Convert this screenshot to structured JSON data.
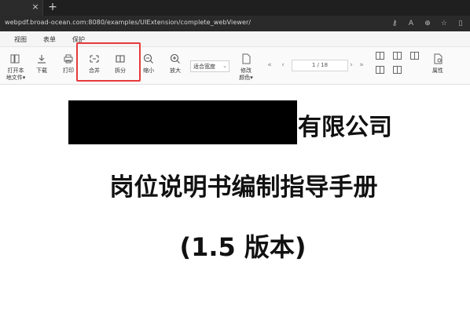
{
  "browser": {
    "tab_close": "×",
    "new_tab": "+",
    "url": "webpdf.broad-ocean.com:8080/examples/UIExtension/complete_webViewer/",
    "icons": [
      "key-icon",
      "translate-icon",
      "zoom-icon",
      "favorite-icon",
      "split-screen-icon"
    ]
  },
  "menu": {
    "items": [
      "视图",
      "表单",
      "保护"
    ]
  },
  "toolbar": {
    "open": {
      "line1": "打开本",
      "line2": "地文件▾"
    },
    "download": "下载",
    "print": "打印",
    "merge": "合并",
    "split": "拆分",
    "zoom_out": "缩小",
    "zoom_in": "放大",
    "zoom_mode": "适合宽度",
    "modify_color": {
      "line1": "修改",
      "line2": "颜色▾"
    },
    "page_indicator": "1 / 18",
    "properties": "属性",
    "highlight_color": "#e63a3a"
  },
  "document": {
    "company_suffix": "有限公司",
    "title": "岗位说明书编制指导手册",
    "version": "(1.5 版本)"
  }
}
